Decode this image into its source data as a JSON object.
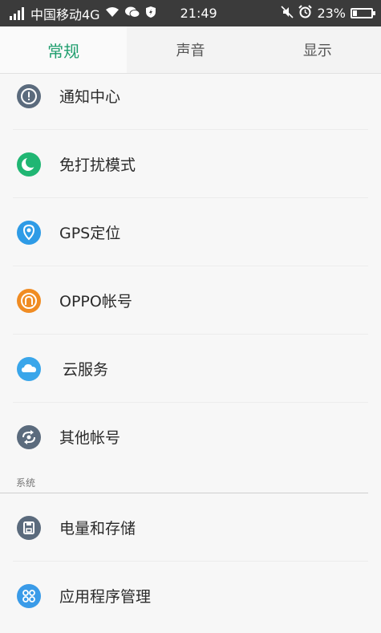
{
  "status_bar": {
    "carrier": "中国移动4G",
    "time": "21:49",
    "battery": "23%"
  },
  "tabs": [
    {
      "label": "常规",
      "active": true
    },
    {
      "label": "声音",
      "active": false
    },
    {
      "label": "显示",
      "active": false
    }
  ],
  "colors": {
    "accent": "#1f9e6e",
    "notification": "#5b6b7d",
    "dnd": "#20b673",
    "gps": "#2e9be6",
    "oppo": "#f08c23",
    "cloud": "#3aa6ea",
    "other_accounts": "#5b6b7d",
    "storage": "#5b6b7d",
    "apps": "#3a9be8"
  },
  "items_top": [
    {
      "label": "通知中心",
      "icon": "exclamation-icon"
    },
    {
      "label": "免打扰模式",
      "icon": "moon-icon"
    },
    {
      "label": "GPS定位",
      "icon": "location-pin-icon"
    },
    {
      "label": "OPPO帐号",
      "icon": "account-icon"
    },
    {
      "label": "云服务",
      "icon": "cloud-icon"
    },
    {
      "label": "其他帐号",
      "icon": "sync-icon"
    }
  ],
  "section_system": {
    "title": "系统"
  },
  "items_system": [
    {
      "label": "电量和存储",
      "icon": "storage-icon"
    },
    {
      "label": "应用程序管理",
      "icon": "apps-icon"
    }
  ]
}
